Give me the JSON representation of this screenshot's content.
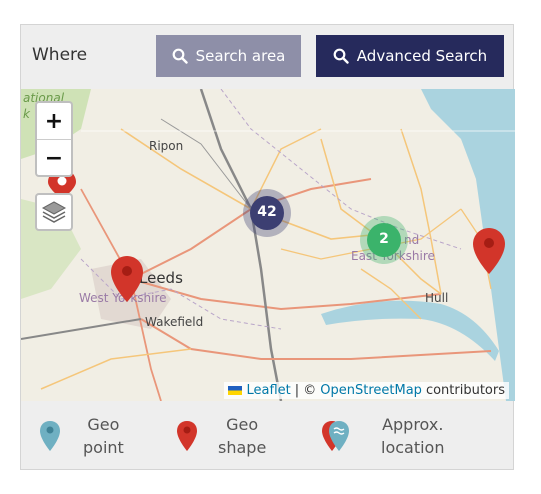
{
  "header": {
    "where_label": "Where",
    "search_area_label": "Search area",
    "advanced_search_label": "Advanced Search"
  },
  "map": {
    "zoom_in_label": "+",
    "zoom_out_label": "−",
    "places": {
      "ripon": "Ripon",
      "leeds": "Leeds",
      "wakefield": "Wakefield",
      "west_yorkshire": "West Yorkshire",
      "east_yorkshire": "East Yorkshire",
      "hull": "Hull",
      "national_park_frag1": "ational",
      "national_park_frag2": "k",
      "east_frag": "nd"
    },
    "clusters": [
      {
        "count": "42",
        "color": "#3c3f72"
      },
      {
        "count": "2",
        "color": "#3bb36b"
      }
    ],
    "attribution": {
      "leaflet": "Leaflet",
      "separator": "| ©",
      "osm": "OpenStreetMap",
      "suffix": "contributors"
    }
  },
  "legend": {
    "geo_point": {
      "label": "Geo point",
      "line1": "Geo",
      "line2": "point",
      "icon": "teal-marker-icon",
      "color": "#6fb0c2"
    },
    "geo_shape": {
      "label": "Geo shape",
      "line1": "Geo",
      "line2": "shape",
      "icon": "red-marker-icon",
      "color": "#d2352a"
    },
    "approx_location": {
      "label": "Approx. location",
      "line1": "Approx.",
      "line2": "location",
      "icon": "approx-marker-icon"
    }
  },
  "colors": {
    "search_area_bg": "#8e8fa8",
    "advanced_search_bg": "#262a5c",
    "marker_red": "#d2352a",
    "sea": "#aad3df"
  }
}
